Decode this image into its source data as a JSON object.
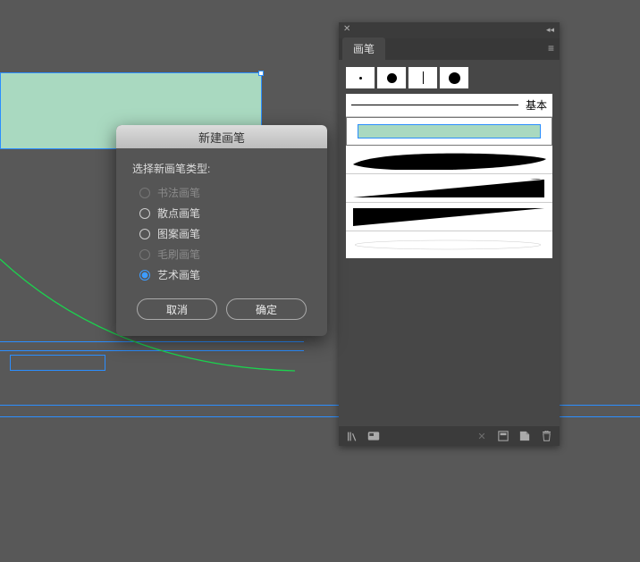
{
  "panel": {
    "tab_label": "画笔",
    "basic_label": "基本",
    "thumbs": [
      "dot-sm",
      "dot-md",
      "bar",
      "dot-lg"
    ]
  },
  "dialog": {
    "title": "新建画笔",
    "prompt": "选择新画笔类型:",
    "options": [
      {
        "label": "书法画笔",
        "enabled": false,
        "checked": false
      },
      {
        "label": "散点画笔",
        "enabled": true,
        "checked": false
      },
      {
        "label": "图案画笔",
        "enabled": true,
        "checked": false
      },
      {
        "label": "毛刷画笔",
        "enabled": false,
        "checked": false
      },
      {
        "label": "艺术画笔",
        "enabled": true,
        "checked": true
      }
    ],
    "cancel": "取消",
    "ok": "确定"
  },
  "colors": {
    "mint": "#a9d9c0",
    "selection": "#2b8eff",
    "panel_bg": "#474747"
  }
}
